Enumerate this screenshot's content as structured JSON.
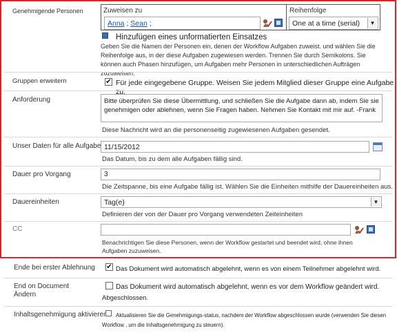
{
  "approvers": {
    "label": "Genehmigende Personen",
    "col_assign": "Zuweisen zu",
    "col_order": "Reihenfolge",
    "names_value": "Anna ; Sean ;",
    "name_1": "Anna",
    "name_2": "Sean",
    "order_value": "One at a time (serial)",
    "add_unformatted": "Hinzufügen eines unformatierten Einsatzes",
    "description": "Geben Sie die Namen der Personen ein, denen der Workflow Aufgaben zuweist. und wählen Sie die Reihenfolge aus, in der diese Aufgaben zugewiesen werden. Trennen Sie durch Semikolons. Sie können auch Phasen hinzufügen, um Aufgaben mehr Personen in unterschiedlichen Aufträgen zuzuweisen."
  },
  "expand_groups": {
    "label": "Gruppen erweitern",
    "checkbox_text": "Für jede eingegebene Gruppe. Weisen Sie jedem Mitglied dieser Gruppe eine Aufgabe zu.",
    "checked": true
  },
  "request": {
    "label": "Anforderung",
    "value": "Bitte überprüfen Sie diese Übermittlung, und schließen Sie die Aufgabe dann ab, indem Sie sie genehmigen oder ablehnen, wenn Sie Fragen haben. Nehmen Sie Kontakt mit mir auf. -Frank",
    "description": "Diese Nachricht wird an die personenseitig zugewiesenen Aufgaben gesendet."
  },
  "due_date": {
    "label": "Unser Daten für alle Aufgaben",
    "value": "11/15/2012",
    "description": "Das Datum, bis zu dem alle Aufgaben fällig sind."
  },
  "duration": {
    "label": "Dauer pro Vorgang",
    "value": "3",
    "description": "Die Zeitspanne, bis eine Aufgabe fällig ist. Wählen Sie die Einheiten mithilfe der Dauereinheiten aus."
  },
  "duration_units": {
    "label": "Dauereinheiten",
    "value": "Tag(e)",
    "description": "Definieren der von der Dauer pro Vorgang verwendeten Zeiteinheiten"
  },
  "cc": {
    "label": "CC",
    "value": "",
    "description": "Benachrichtigen Sie diese Personen, wenn der Workflow gestartet und beendet wird, ohne ihnen Aufgaben zuzuweisen."
  },
  "end_first_reject": {
    "label": "Ende bei erster Ablehnung",
    "checkbox_text": "Das Dokument wird automatisch abgelehnt, wenn es von einem Teilnehmer abgelehnt wird.",
    "checked": true
  },
  "end_doc_change": {
    "label": "End on Document Ändern",
    "checkbox_text": "Das Dokument wird automatisch abgelehnt, wenn es vor dem Workflow geändert wird.",
    "extra": "Abgeschlossen.",
    "checked": false
  },
  "content_approval": {
    "label": "Inhaltsgenehmigung aktivieren",
    "checkbox_text": "Aktualisieren Sie die Genehmigungs-status, nachdem der Workflow abgeschlossen wurde (verwenden Sie diesen Workflow , um die Inhaltsgenehmigung zu steuern).",
    "checked": false
  },
  "colors": {
    "frame": "#d9262b",
    "link": "#1a57a8"
  }
}
